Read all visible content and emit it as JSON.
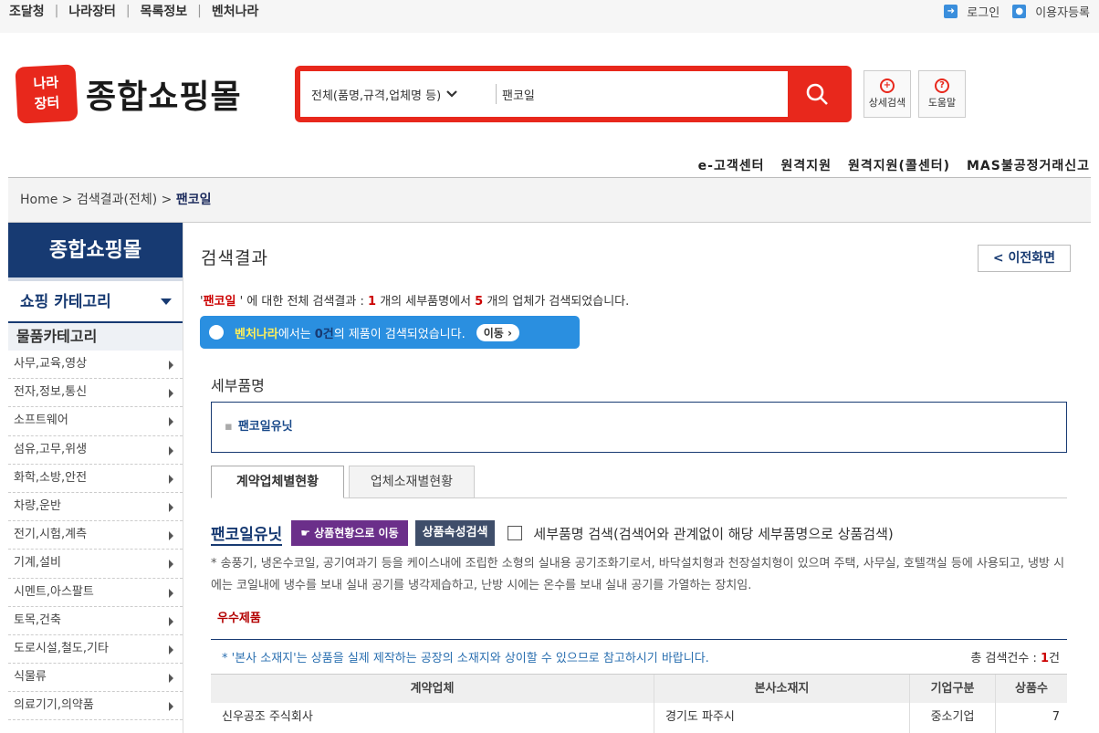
{
  "top": {
    "links": [
      "조달청",
      "나라장터",
      "목록정보",
      "벤처나라"
    ],
    "login": "로그인",
    "register": "이용자등록"
  },
  "logo": {
    "mark_top": "나라",
    "mark_bottom": "장터",
    "text": "종합쇼핑몰"
  },
  "search": {
    "scope": "전체(품명,규격,업체명 등)",
    "query": "팬코일",
    "detail_label": "상세검색",
    "help_label": "도움말"
  },
  "util_links": [
    "e-고객센터",
    "원격지원",
    "원격지원(콜센터)",
    "MAS불공정거래신고"
  ],
  "breadcrumb": {
    "home": "Home",
    "step": "검색결과(전체)",
    "current": "팬코일"
  },
  "sidebar": {
    "header": "종합쇼핑몰",
    "category_toggle": "쇼핑 카테고리",
    "subheader": "물품카테고리",
    "items": [
      "사무,교육,영상",
      "전자,정보,통신",
      "소프트웨어",
      "섬유,고무,위생",
      "화학,소방,안전",
      "차량,운반",
      "전기,시험,계측",
      "기계,설비",
      "시멘트,아스팔트",
      "토목,건축",
      "도로시설,철도,기타",
      "식물류",
      "의료기기,의약품"
    ]
  },
  "main": {
    "title": "검색결과",
    "back_label": "이전화면",
    "summary": {
      "quote_open": "'",
      "query": "팬코일",
      "quote_close": "' 에 대한 전체 검색결과 :",
      "count1": "1",
      "mid": "개의 세부품명에서",
      "count2": "5",
      "end": "개의 업체가 검색되었습니다."
    },
    "notice": {
      "name": "벤처나라",
      "pre": "에서는",
      "count": "0건",
      "post": "의 제품이 검색되었습니다.",
      "go": "이동"
    },
    "detail_section": "세부품명",
    "detail_items": [
      "팬코일유닛"
    ],
    "tabs": [
      "계약업체별현황",
      "업체소재별현황"
    ],
    "product": {
      "name": "팬코일유닛",
      "btn_status": "상품현황으로 이동",
      "btn_attr": "상품속성검색",
      "checkbox_label": "세부품명 검색(검색어와 관계없이 해당 세부품명으로 상품검색)",
      "description": "* 송풍기, 냉온수코일, 공기여과기 등을 케이스내에 조립한 소형의 실내용 공기조화기로서, 바닥설치형과 천장설치형이 있으며 주택, 사무실, 호텔객실 등에 사용되고, 냉방 시에는 코일내에 냉수를 보내 실내 공기를 냉각제습하고, 난방 시에는 온수를 보내 실내 공기를 가열하는 장치임.",
      "best_label": "우수제품"
    },
    "table_note": "* '본사 소재지'는 상품을 실제 제작하는 공장의 소재지와 상이할 수 있으므로 참고하시기 바랍니다.",
    "total_label": "총 검색건수 :",
    "total_count": "1",
    "total_unit": "건",
    "columns": [
      "계약업체",
      "본사소재지",
      "기업구분",
      "상품수"
    ],
    "rows": [
      {
        "company": "신우공조 주식회사",
        "location": "경기도 파주시",
        "type": "중소기업",
        "count": "7"
      }
    ]
  }
}
